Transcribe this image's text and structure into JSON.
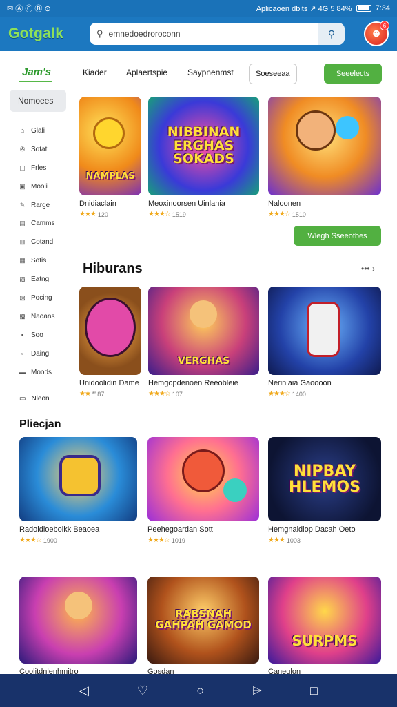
{
  "status": {
    "left": "✉ Ⓐ Ⓒ Ⓑ ⊙",
    "right": "Aplicaoen dbits  ↗  4G 5 84%",
    "time": "7:34"
  },
  "appbar": {
    "logo": "Gotgalk",
    "search_text": "emnedoedroroconn",
    "avatar_badge": "6"
  },
  "sidebar": {
    "title": "Jam's",
    "active": "Nomoees",
    "items": [
      {
        "icon": "⌂",
        "label": "Glali"
      },
      {
        "icon": "✇",
        "label": "Sotat"
      },
      {
        "icon": "▢",
        "label": "Frles"
      },
      {
        "icon": "▣",
        "label": "Mooli"
      },
      {
        "icon": "✎",
        "label": "Rarge"
      },
      {
        "icon": "▤",
        "label": "Camms"
      },
      {
        "icon": "▥",
        "label": "Cotand"
      },
      {
        "icon": "▦",
        "label": "Sotis"
      },
      {
        "icon": "▧",
        "label": "Eatng"
      },
      {
        "icon": "▨",
        "label": "Pocing"
      },
      {
        "icon": "▩",
        "label": "Naoans"
      },
      {
        "icon": "▪",
        "label": "Soo"
      },
      {
        "icon": "▫",
        "label": "Daing"
      },
      {
        "icon": "▬",
        "label": "Moods"
      }
    ],
    "last": {
      "icon": "▭",
      "label": "Nleon"
    }
  },
  "tabs": {
    "t1": "Kiader",
    "t2": "Aplaertspie",
    "t3": "Saypnenmst",
    "t4": "Soeseeaa",
    "t5": "Seeelects"
  },
  "featured": [
    {
      "name": "Dnidiaclain",
      "rating": "120",
      "art": "NAMPLAS"
    },
    {
      "name": "Meoxinoorsen Uinlania",
      "rating": "",
      "art": "NIBBINAN ERGHAS SOKADS"
    },
    {
      "name": "Naloonen",
      "rating": "",
      "art": ""
    }
  ],
  "more_button": "Wlegh Sseeotbes",
  "hiburans": {
    "title": "Hiburans",
    "arrow": "••• ›",
    "cards": [
      {
        "name": "Unidoolidin Dame",
        "rating": "′‴ 87",
        "art": ""
      },
      {
        "name": "Hemgopdenoen Reeobleie",
        "rating": "107",
        "art": "VERGHAS"
      },
      {
        "name": "Neriniaia Gaoooon",
        "rating": "1400",
        "art": ""
      }
    ]
  },
  "pricgan": {
    "title": "Pliecjan",
    "cards": [
      {
        "name": "Radoidioeboikk Beaoea",
        "rating": "1900",
        "art": ""
      },
      {
        "name": "Peehegoardan Sott",
        "rating": "1019",
        "art": ""
      },
      {
        "name": "Hemgnaidiop Dacah Oeto",
        "rating": "1003",
        "art": "NIPBAY HLEMOS"
      }
    ]
  },
  "bottom_row": [
    {
      "name": "Coolitdnlenhmitro",
      "art": ""
    },
    {
      "name": "Gosdan",
      "art": "RABSNAH GAHPAH GAMOD"
    },
    {
      "name": "Caneglon",
      "art": "SURPMS"
    }
  ],
  "navbar": {
    "back": "◁",
    "assist": "♡",
    "home": "○",
    "chat": "⌲",
    "recent": "□"
  }
}
